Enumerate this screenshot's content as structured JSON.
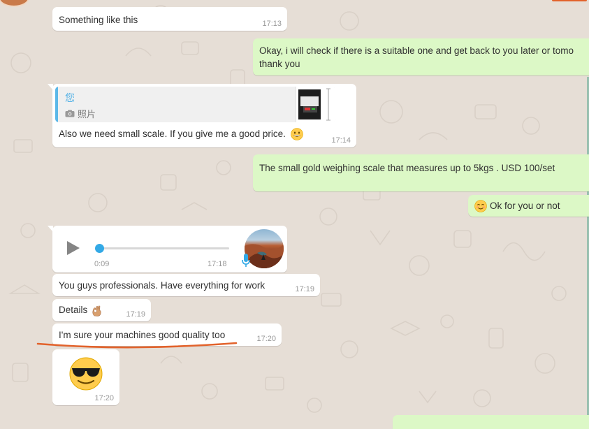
{
  "messages": [
    {
      "id": "m1",
      "dir": "in",
      "text": "Something like this",
      "time": "17:13"
    },
    {
      "id": "m2",
      "dir": "out",
      "lines": [
        "Okay, i will check if there is a suitable one and get back to you later or tomo",
        "thank you"
      ]
    },
    {
      "id": "m3",
      "dir": "in",
      "quote": {
        "name": "您",
        "sub": "照片"
      },
      "text": "Also we need small scale. If you give me a good price.",
      "emoji": "grinning-face",
      "time": "17:14"
    },
    {
      "id": "m4",
      "dir": "out",
      "text": "The small gold weighing scale that measures up  to 5kgs . USD 100/set"
    },
    {
      "id": "m5",
      "dir": "out",
      "emoji": "smiling-face",
      "text": "Ok for you or not"
    },
    {
      "id": "m6",
      "dir": "in",
      "type": "voice",
      "duration": "0:09",
      "time": "17:18"
    },
    {
      "id": "m7",
      "dir": "in",
      "text": "You guys professionals. Have everything for work",
      "time": "17:19"
    },
    {
      "id": "m8",
      "dir": "in",
      "text": "Details",
      "emoji": "ok-hand",
      "time": "17:19"
    },
    {
      "id": "m9",
      "dir": "in",
      "text": "I'm sure your machines good quality too",
      "time": "17:20"
    },
    {
      "id": "m10",
      "dir": "in",
      "emoji": "sunglasses-face",
      "time": "17:20"
    }
  ],
  "colors": {
    "incoming": "#ffffff",
    "outgoing": "#dcf8c6",
    "annotation": "#e2622b",
    "accent": "#33a9e6"
  }
}
